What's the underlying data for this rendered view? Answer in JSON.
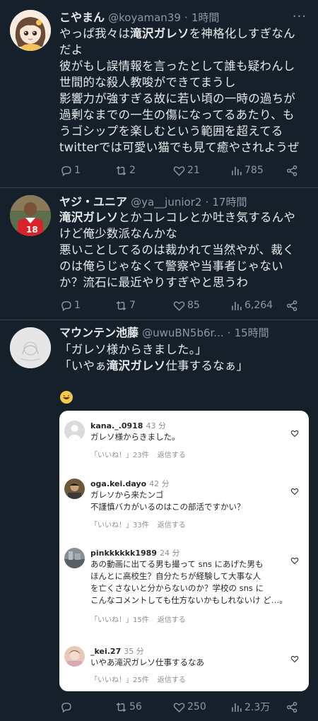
{
  "tweets": [
    {
      "name": "こやまん",
      "handle": "@koyaman39",
      "time": "1時間",
      "body": [
        [
          "やっぱ我々は",
          "滝沢ガレソ",
          "を神格化しすぎなん"
        ],
        [
          "だよ"
        ],
        [
          "彼がもし誤情報を言ったとして誰も疑わんし"
        ],
        [
          "世間的な殺人教唆ができてまうし"
        ],
        [
          "影響力が強すぎる故に若い頃の一時の過ちが"
        ],
        [
          "過剰なまでの一生の傷になってるあたり、も"
        ],
        [
          "うゴシップを楽しむという範囲を超えてる"
        ],
        [
          "twitterでは可愛い猫でも見て癒やされようぜ"
        ]
      ],
      "replies": "1",
      "retweets": "2",
      "likes": "21",
      "views": "785"
    },
    {
      "name": "ヤジ・ユニア",
      "handle": "@ya__junior2",
      "time": "17時間",
      "body": [
        [
          "",
          "滝沢ガレソ",
          "とかコレコレとか吐き気するんや"
        ],
        [
          "けど俺少数派なんかな"
        ],
        [
          "悪いことしてるのは裁かれて当然やが、裁く"
        ],
        [
          "のは俺らじゃなくて警察や当事者じゃない"
        ],
        [
          "か？流石に最近やりすぎやと思うわ"
        ]
      ],
      "replies": "1",
      "retweets": "7",
      "likes": "85",
      "views": "6,264"
    },
    {
      "name": "マウンテン池藤",
      "handle": "@uwuBN5b6r...",
      "time": "15時間",
      "body": [
        [
          "「ガレソ様からきました。」"
        ],
        [
          "「いやぁ",
          "滝沢ガレソ",
          "仕事するなぁ」"
        ]
      ],
      "replies": "",
      "retweets": "56",
      "likes": "250",
      "views": "2.3万"
    }
  ],
  "embed_comments": [
    {
      "user": "kana._.0918",
      "age": "43 分",
      "lines": [
        "ガレソ様からきました。"
      ],
      "likes": "「いいね！」23件",
      "reply": "返信する"
    },
    {
      "user": "oga.kei.dayo",
      "age": "42 分",
      "lines": [
        "ガレソから来たンゴ",
        "不謹慎バカがいるのはこの部活ですかい？"
      ],
      "likes": "「いいね！」33件",
      "reply": "返信する"
    },
    {
      "user": "pinkkkkkk1989",
      "age": "24 分",
      "lines": [
        "あの動画に出てる男も撮って sns にあげた男も",
        "ほんとに高校生？自分たちが経験して大事な人",
        "を亡くさないと分からないのか？学校の sns に",
        "こんなコメントしても仕方ないかもしれないけ ど…。"
      ],
      "likes": "「いいね！」15件",
      "reply": "返信する"
    },
    {
      "user": "_kei.27",
      "age": "35 分",
      "lines": [
        "いやあ滝沢ガレソ仕事するなあ"
      ],
      "likes": "「いいね！」25件",
      "reply": "返信する"
    }
  ],
  "colors": {
    "background": "#15202b",
    "divider": "#38444d",
    "text": "#e7e9ea",
    "muted": "#8b98a5"
  }
}
